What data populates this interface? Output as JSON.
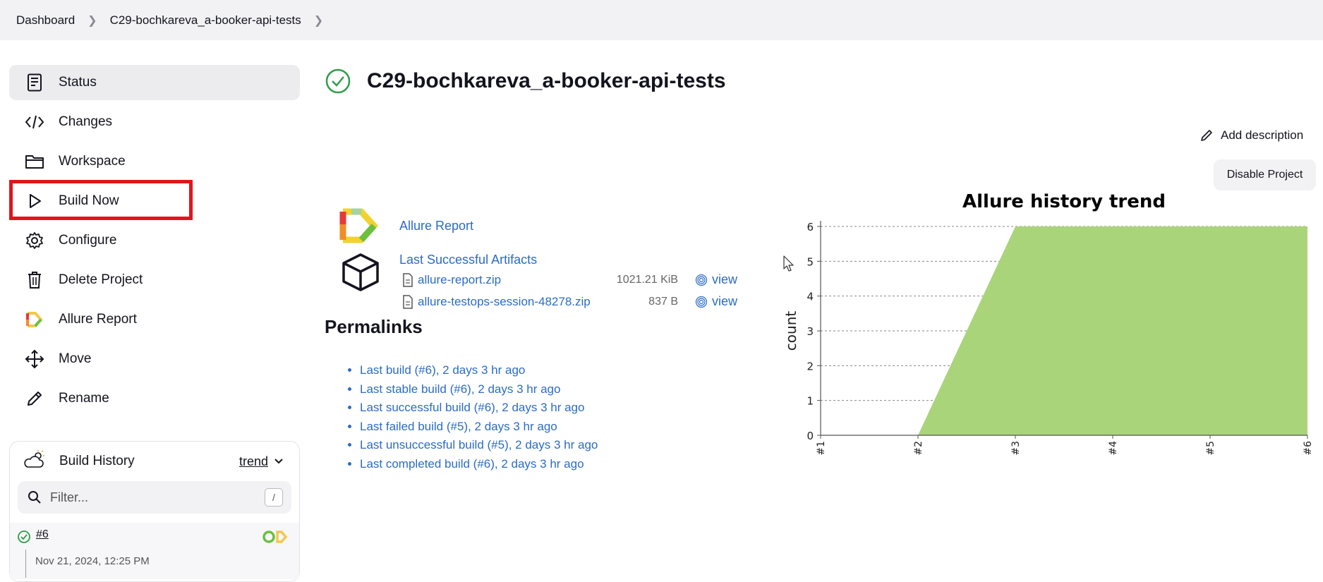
{
  "breadcrumb": {
    "items": [
      "Dashboard",
      "C29-bochkareva_a-booker-api-tests"
    ]
  },
  "sidebar": {
    "items": [
      {
        "label": "Status",
        "icon": "status-icon"
      },
      {
        "label": "Changes",
        "icon": "code-icon"
      },
      {
        "label": "Workspace",
        "icon": "folder-icon"
      },
      {
        "label": "Build Now",
        "icon": "play-icon"
      },
      {
        "label": "Configure",
        "icon": "gear-icon"
      },
      {
        "label": "Delete Project",
        "icon": "trash-icon"
      },
      {
        "label": "Allure Report",
        "icon": "allure-icon"
      },
      {
        "label": "Move",
        "icon": "move-icon"
      },
      {
        "label": "Rename",
        "icon": "pencil-icon"
      }
    ]
  },
  "build_history": {
    "title": "Build History",
    "trend_label": "trend",
    "filter_placeholder": "Filter...",
    "filter_shortcut": "/",
    "builds": [
      {
        "number": "#6",
        "date": "Nov 21, 2024, 12:25 PM"
      }
    ]
  },
  "main": {
    "title": "C29-bochkareva_a-booker-api-tests",
    "add_description": "Add description",
    "disable_project": "Disable Project",
    "allure_report_link": "Allure Report",
    "last_successful_artifacts": "Last Successful Artifacts",
    "artifacts": [
      {
        "name": "allure-report.zip",
        "size": "1021.21 KiB",
        "view": "view"
      },
      {
        "name": "allure-testops-session-48278.zip",
        "size": "837 B",
        "view": "view"
      }
    ],
    "permalinks_title": "Permalinks",
    "permalinks": [
      "Last build (#6), 2 days 3 hr ago",
      "Last stable build (#6), 2 days 3 hr ago",
      "Last successful build (#6), 2 days 3 hr ago",
      "Last failed build (#5), 2 days 3 hr ago",
      "Last unsuccessful build (#5), 2 days 3 hr ago",
      "Last completed build (#6), 2 days 3 hr ago"
    ]
  },
  "colors": {
    "accent_link": "#2b6cc4",
    "success": "#2e9e48",
    "highlight": "#e0161b",
    "chart_fill": "#aad47a"
  },
  "chart_data": {
    "type": "area",
    "title": "Allure history trend",
    "ylabel": "count",
    "xlabel": "",
    "categories": [
      "#1",
      "#2",
      "#3",
      "#4",
      "#5",
      "#6"
    ],
    "series": [
      {
        "values": [
          null,
          0,
          6,
          6,
          6,
          6
        ]
      }
    ],
    "yticks": [
      0,
      1,
      2,
      3,
      4,
      5,
      6
    ],
    "ylim": [
      0,
      6
    ],
    "grid": true
  }
}
